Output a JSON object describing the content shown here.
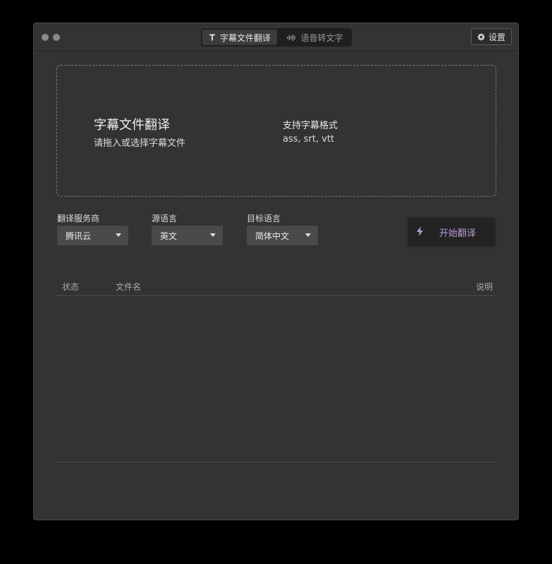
{
  "tabs": [
    {
      "label": "字幕文件翻译",
      "icon": "text-icon",
      "active": true
    },
    {
      "label": "语音转文字",
      "icon": "waveform-icon",
      "active": false
    }
  ],
  "settings": {
    "label": "设置",
    "icon": "gear-icon"
  },
  "dropzone": {
    "title": "字幕文件翻译",
    "subtitle": "请拖入或选择字幕文件",
    "formats_title": "支持字幕格式",
    "formats": "ass, srt, vtt"
  },
  "options": {
    "provider": {
      "label": "翻译服务商",
      "value": "腾讯云"
    },
    "source": {
      "label": "源语言",
      "value": "英文"
    },
    "target": {
      "label": "目标语言",
      "value": "简体中文"
    }
  },
  "start": {
    "label": "开始翻译",
    "icon": "bolt-icon",
    "color": "#b79bd6"
  },
  "table": {
    "columns": [
      "状态",
      "文件名",
      "说明"
    ],
    "rows": []
  }
}
